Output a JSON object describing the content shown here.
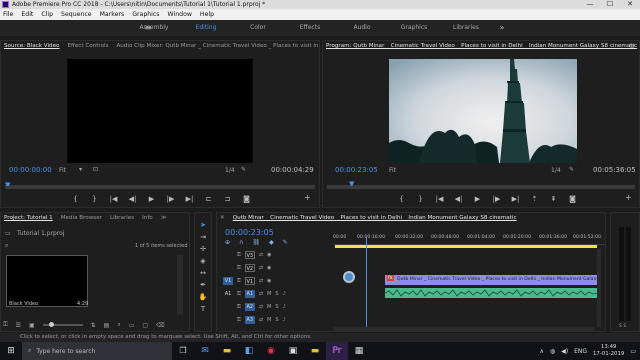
{
  "window": {
    "title": "Adobe Premiere Pro CC 2018 - C:\\Users\\nitin\\Documents\\Tutorial 1\\Tutorial 1.prproj *",
    "minimize": "—",
    "maximize": "☐",
    "close": "✕"
  },
  "menu": [
    "File",
    "Edit",
    "Clip",
    "Sequence",
    "Markers",
    "Graphics",
    "Window",
    "Help"
  ],
  "workspaces": {
    "items": [
      "Assembly",
      "Editing",
      "Color",
      "Effects",
      "Audio",
      "Graphics",
      "Libraries"
    ],
    "active": "Editing",
    "more": "»",
    "menu": "≡"
  },
  "source": {
    "tabs": [
      "Source: Black Video",
      "Effect Controls",
      "Audio Clip Mixer: Qutb Minar _ Cinematic Travel Video _ Places to visit in De",
      "≫"
    ],
    "timecode_in": "00:00:00:00",
    "fit": "Fit",
    "ratio": "1/4",
    "timecode_out": "00:00:04:29"
  },
  "program": {
    "tab": "Program: Qutb Minar _ Cinematic Travel Video _ Places to visit in Delhi _ Indian Monument Galaxy S8 cinematic",
    "menu": "≡",
    "timecode_in": "00:00:23:05",
    "fit": "Fit",
    "ratio": "1/4",
    "timecode_out": "00:05:36:05"
  },
  "project": {
    "tabs": [
      "Project: Tutorial 1",
      "Media Browser",
      "Libraries",
      "Info",
      "≫"
    ],
    "file": "Tutorial 1.prproj",
    "selection": "1 of 5 items selected",
    "thumb_label": "Black Video",
    "thumb_duration": "4:29"
  },
  "timeline": {
    "tab": "Qutb Minar _ Cinematic Travel Video _ Places to visit in Delhi _ Indian Monument Galaxy S8 cinematic",
    "timecode": "00:00:23:05",
    "ruler": [
      "00:00",
      "00:00:16:00",
      "00:00:32:00",
      "00:00:48:00",
      "00:01:04:00",
      "00:01:20:00",
      "00:01:36:00",
      "00:01:52:00"
    ],
    "tracks": [
      {
        "src": "",
        "name": "V3"
      },
      {
        "src": "",
        "name": "V2"
      },
      {
        "src": "V1",
        "name": "V1"
      },
      {
        "src": "A1",
        "name": "A1"
      },
      {
        "src": "",
        "name": "A2"
      },
      {
        "src": "",
        "name": "A3"
      }
    ],
    "video_clip": "Qutb Minar _ Cinematic Travel Video _ Places to visit in Delhi _ Indian Monument Galaxy S8 cinematic.mp4 [V]",
    "audio_clip": "",
    "m_label": "M",
    "s_label": "S",
    "playhead_fraction": 0.121
  },
  "status": "Click to select, or click in empty space and drag to marquee select. Use Shift, Alt, and Ctrl for other options.",
  "taskbar": {
    "search_placeholder": "Type here to search",
    "tray": [
      "∧",
      "ENG"
    ],
    "time": "13:49",
    "date": "17-01-2019"
  },
  "colors": {
    "accent": "#4a90e8",
    "clip_video": "#8d8de6",
    "clip_audio": "#4bbb8e",
    "timeline_bar": "#f0e050"
  }
}
